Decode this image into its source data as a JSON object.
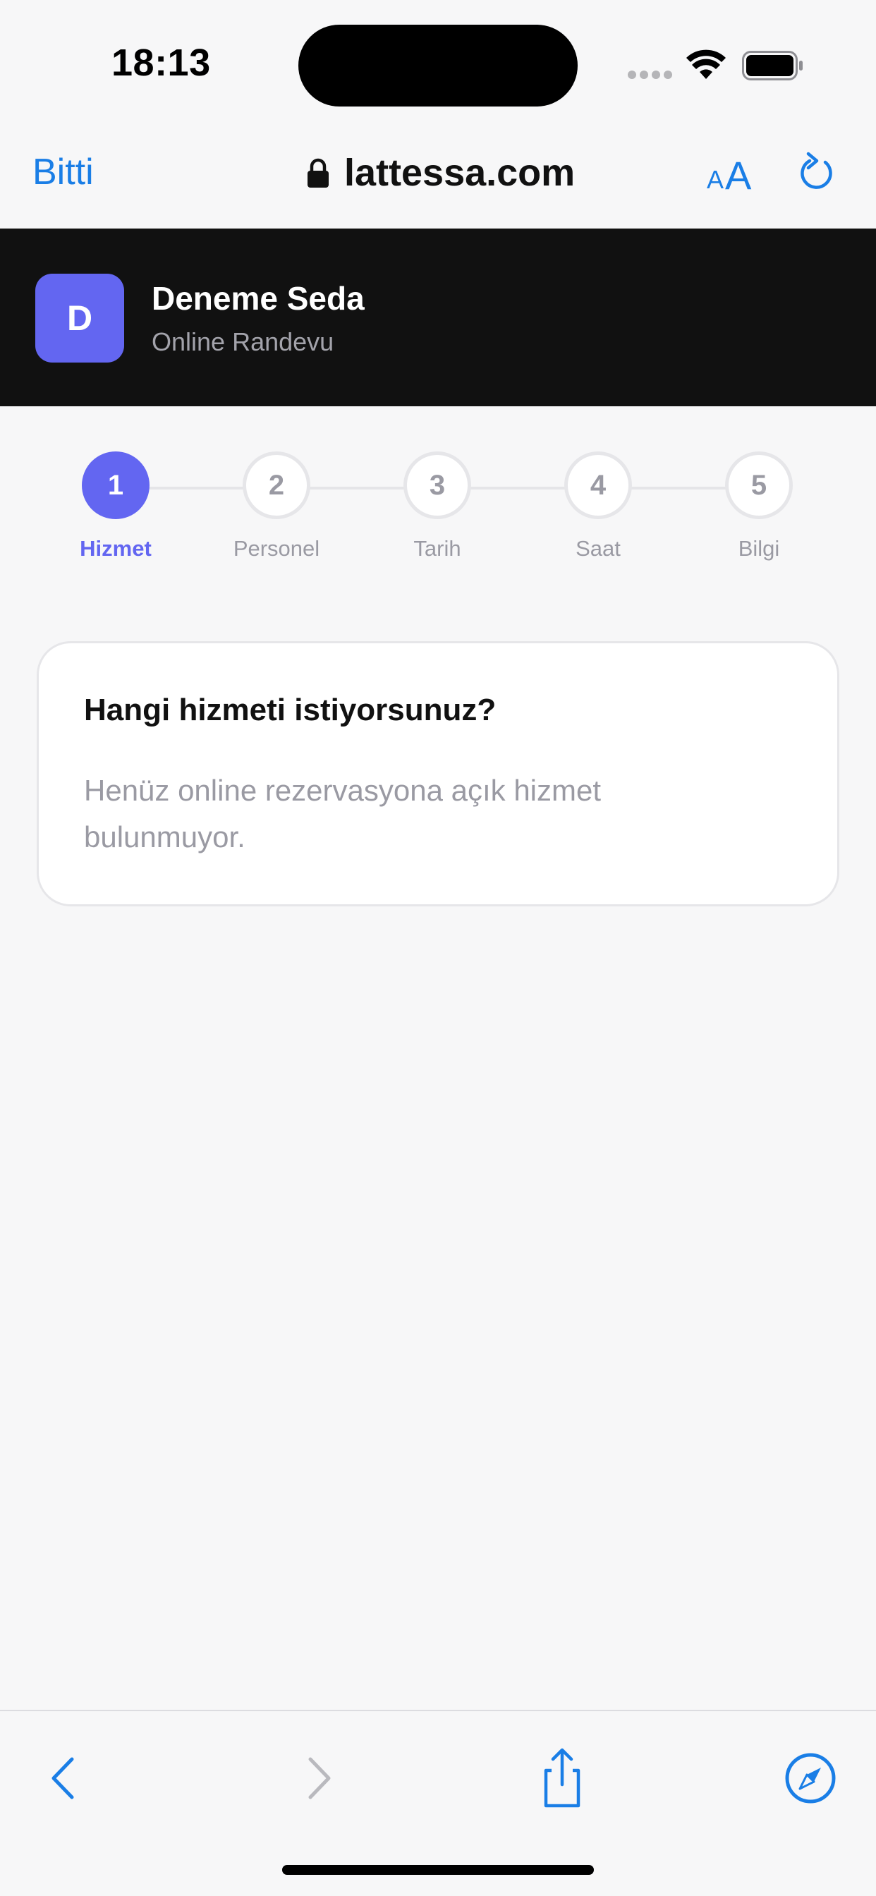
{
  "status_bar": {
    "time": "18:13"
  },
  "browser": {
    "done_label": "Bitti",
    "url": "lattessa.com",
    "text_size_small": "A",
    "text_size_large": "A",
    "accent_color": "#1a7ee6"
  },
  "header": {
    "avatar_letter": "D",
    "business_name": "Deneme Seda",
    "subtitle": "Online Randevu",
    "avatar_color": "#6366f1",
    "background_color": "#111111"
  },
  "stepper": {
    "active_index": 0,
    "steps": [
      {
        "number": "1",
        "label": "Hizmet"
      },
      {
        "number": "2",
        "label": "Personel"
      },
      {
        "number": "3",
        "label": "Tarih"
      },
      {
        "number": "4",
        "label": "Saat"
      },
      {
        "number": "5",
        "label": "Bilgi"
      }
    ]
  },
  "service_card": {
    "title": "Hangi hizmeti istiyorsunuz?",
    "empty_text": "Henüz online rezervasyona açık hizmet bulunmuyor."
  },
  "toolbar": {
    "icons": [
      "back-icon",
      "forward-icon",
      "share-icon",
      "safari-compass-icon"
    ]
  }
}
